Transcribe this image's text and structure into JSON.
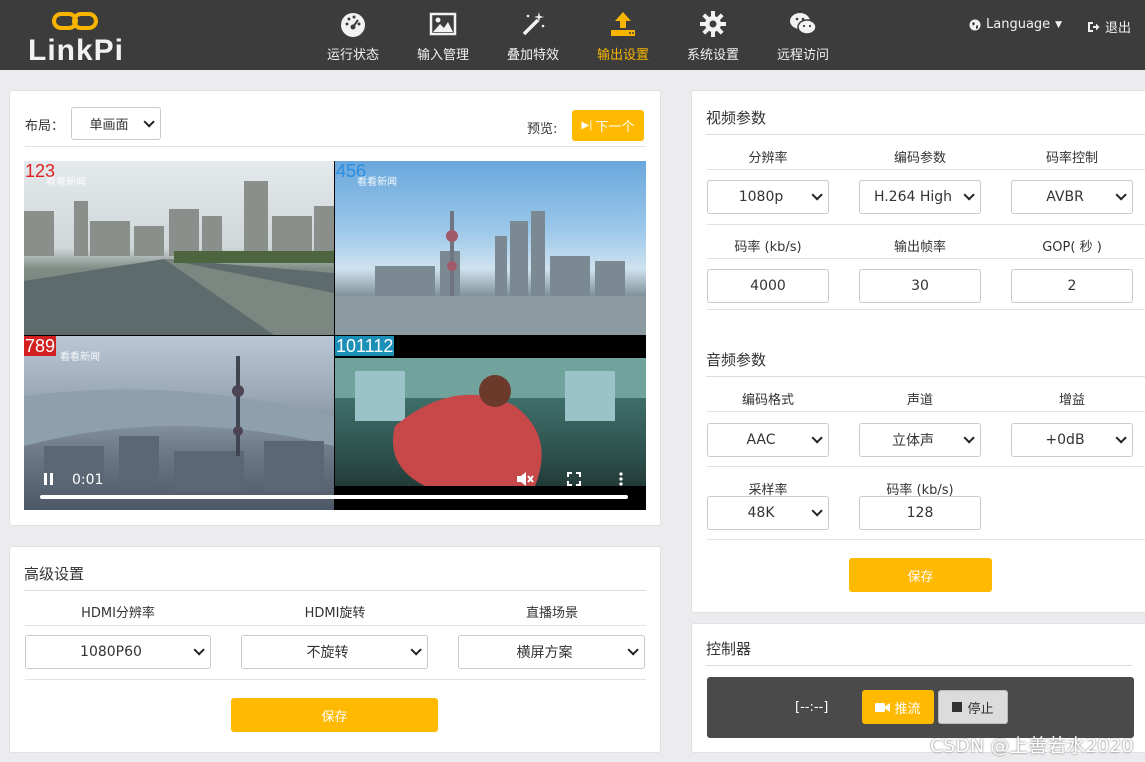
{
  "brand": {
    "logo_text": "LinkPi",
    "accent": "#f7b500",
    "nav_bg": "#3c3c3c"
  },
  "nav": {
    "items": [
      {
        "label": "运行状态",
        "icon": "dashboard-icon"
      },
      {
        "label": "输入管理",
        "icon": "image-icon"
      },
      {
        "label": "叠加特效",
        "icon": "magic-wand-icon"
      },
      {
        "label": "输出设置",
        "icon": "upload-icon",
        "active": true
      },
      {
        "label": "系统设置",
        "icon": "gear-icon"
      },
      {
        "label": "远程访问",
        "icon": "wechat-icon"
      }
    ],
    "language": "Language",
    "logout": "退出"
  },
  "preview": {
    "layout_label": "布局：",
    "layout_value": "单画面",
    "preview_label": "预览:",
    "next_button": "下一个",
    "tiles": [
      {
        "tag": "123",
        "tag_color": "#e02020",
        "watermark": "看看新闻"
      },
      {
        "tag": "456",
        "tag_color": "#2a8fe0",
        "watermark": "看看新闻"
      },
      {
        "tag": "789",
        "tag_color": "#ffffff",
        "watermark": "看看新闻"
      },
      {
        "tag": "101112",
        "tag_color": "#ffffff",
        "watermark": ""
      }
    ],
    "time": "0:01"
  },
  "advanced": {
    "title": "高级设置",
    "headers": [
      "HDMI分辨率",
      "HDMI旋转",
      "直播场景"
    ],
    "values": [
      "1080P60",
      "不旋转",
      "横屏方案"
    ],
    "save": "保存"
  },
  "video_params": {
    "title": "视频参数",
    "row1_headers": [
      "分辨率",
      "编码参数",
      "码率控制"
    ],
    "row1_values": [
      "1080p",
      "H.264 High",
      "AVBR"
    ],
    "row2_headers": [
      "码率 (kb/s)",
      "输出帧率",
      "GOP( 秒 )"
    ],
    "row2_values": [
      "4000",
      "30",
      "2"
    ]
  },
  "audio_params": {
    "title": "音频参数",
    "row1_headers": [
      "编码格式",
      "声道",
      "增益"
    ],
    "row1_values": [
      "AAC",
      "立体声",
      "+0dB"
    ],
    "row2_headers": [
      "采样率",
      "码率 (kb/s)"
    ],
    "row2_values": [
      "48K",
      "128"
    ],
    "save": "保存"
  },
  "controller": {
    "title": "控制器",
    "timer": "[--:--]",
    "push": "推流",
    "stop": "停止"
  },
  "watermark": "CSDN @上善若水2020"
}
